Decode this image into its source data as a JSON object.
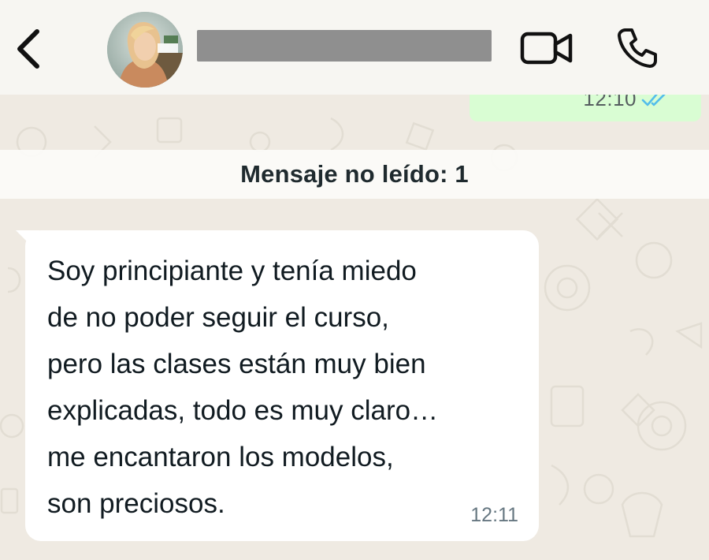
{
  "header": {
    "back_icon": "chevron-left-icon",
    "avatar_icon": "contact-photo",
    "contact_name": "",
    "video_icon": "video-camera-icon",
    "call_icon": "phone-icon"
  },
  "chat": {
    "sent_message": {
      "time": "12:10",
      "status_icon": "double-check-read-icon",
      "status_color": "#53bdeb"
    },
    "unread_banner": "Mensaje no leído: 1",
    "received_message": {
      "lines": [
        "Soy principiante y tenía miedo",
        "de no poder seguir el curso,",
        "pero las clases están muy bien",
        "explicadas, todo es muy claro…",
        "me encantaron los modelos,",
        "son preciosos."
      ],
      "time": "12:11"
    }
  },
  "colors": {
    "header_bg": "#f7f6f2",
    "chat_bg": "#efeae2",
    "sent_bubble": "#d9fdd3",
    "received_bubble": "#ffffff",
    "redaction": "#8f8f8f"
  }
}
